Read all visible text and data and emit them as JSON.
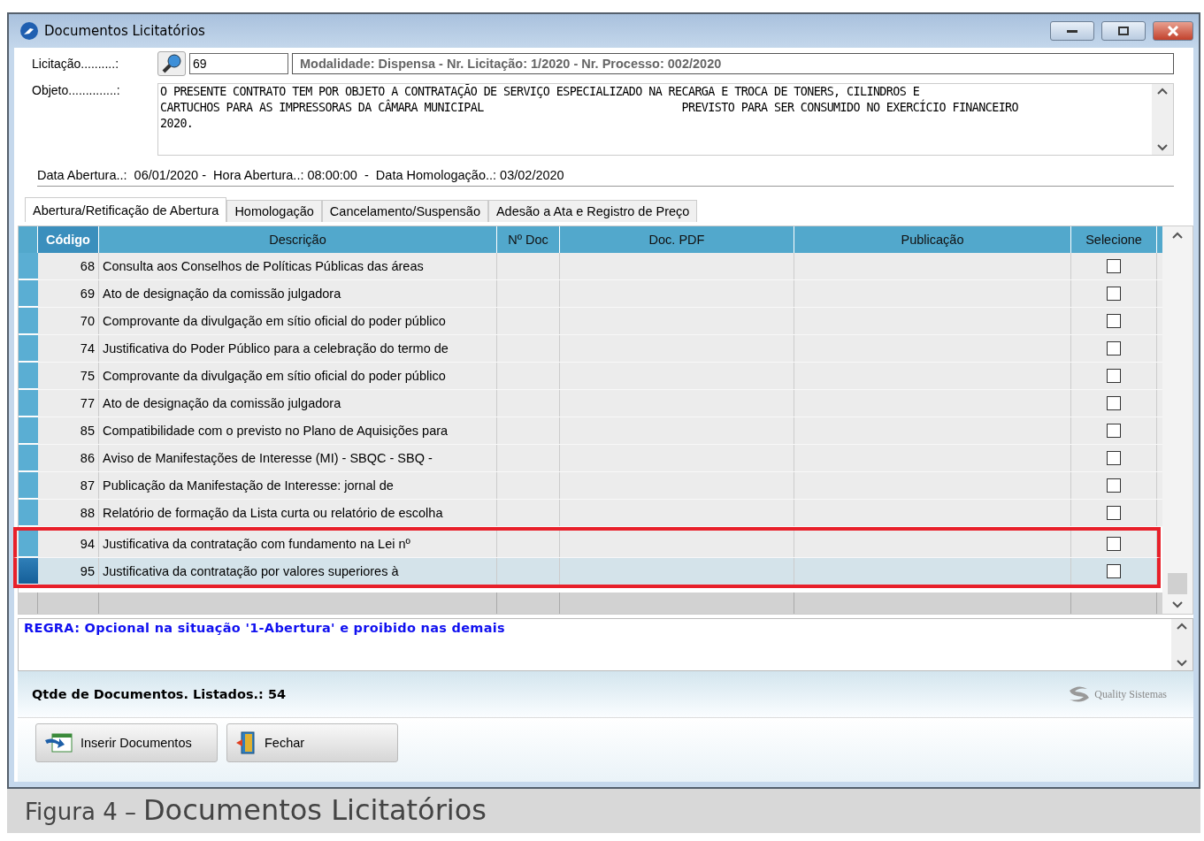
{
  "window": {
    "title": "Documentos Licitatórios"
  },
  "licitacao": {
    "label": "Licitação..........:",
    "value": "69",
    "summary": "Modalidade: Dispensa - Nr. Licitação: 1/2020 - Nr. Processo: 002/2020"
  },
  "objeto": {
    "label": "Objeto..............:",
    "lines": [
      "O PRESENTE CONTRATO TEM POR OBJETO A CONTRATAÇÃO DE SERVIÇO ESPECIALIZADO NA RECARGA E TROCA DE TONERS, CILINDROS E",
      "CARTUCHOS PARA AS IMPRESSORAS DA CÂMARA MUNICIPAL                              PREVISTO PARA SER CONSUMIDO NO EXERCÍCIO FINANCEIRO",
      "2020."
    ]
  },
  "dates": "Data Abertura..:  06/01/2020 -  Hora Abertura..: 08:00:00  -  Data Homologação..: 03/02/2020",
  "tabs": [
    {
      "label": "Abertura/Retificação de Abertura",
      "selected": true
    },
    {
      "label": "Homologação",
      "selected": false
    },
    {
      "label": "Cancelamento/Suspensão",
      "selected": false
    },
    {
      "label": "Adesão a Ata e Registro de Preço",
      "selected": false
    }
  ],
  "table": {
    "columns": [
      "Código",
      "Descrição",
      "Nº Doc",
      "Doc. PDF",
      "Publicação",
      "Selecione"
    ],
    "rows": [
      {
        "codigo": "68",
        "descricao": "Consulta aos Conselhos de Políticas Públicas das áreas",
        "checked": false,
        "selected": false,
        "highlighted": false
      },
      {
        "codigo": "69",
        "descricao": "Ato de designação da comissão julgadora",
        "checked": false,
        "selected": false,
        "highlighted": false
      },
      {
        "codigo": "70",
        "descricao": "Comprovante da divulgação em sítio oficial do poder público",
        "checked": false,
        "selected": false,
        "highlighted": false
      },
      {
        "codigo": "74",
        "descricao": "Justificativa do Poder Público para a celebração do termo de",
        "checked": false,
        "selected": false,
        "highlighted": false
      },
      {
        "codigo": "75",
        "descricao": "Comprovante da divulgação em sítio oficial do poder público",
        "checked": false,
        "selected": false,
        "highlighted": false
      },
      {
        "codigo": "77",
        "descricao": "Ato de designação da comissão julgadora",
        "checked": false,
        "selected": false,
        "highlighted": false
      },
      {
        "codigo": "85",
        "descricao": "Compatibilidade com o previsto no Plano de Aquisições para",
        "checked": false,
        "selected": false,
        "highlighted": false
      },
      {
        "codigo": "86",
        "descricao": "Aviso de Manifestações de Interesse (MI) - SBQC - SBQ -",
        "checked": false,
        "selected": false,
        "highlighted": false
      },
      {
        "codigo": "87",
        "descricao": "Publicação da Manifestação de Interesse: jornal de",
        "checked": false,
        "selected": false,
        "highlighted": false
      },
      {
        "codigo": "88",
        "descricao": "Relatório de formação da Lista curta ou relatório de escolha",
        "checked": false,
        "selected": false,
        "highlighted": false
      },
      {
        "codigo": "94",
        "descricao": "Justificativa da contratação com fundamento na Lei nº",
        "checked": false,
        "selected": false,
        "highlighted": true
      },
      {
        "codigo": "95",
        "descricao": "Justificativa da contratação por valores superiores à",
        "checked": false,
        "selected": true,
        "highlighted": true
      }
    ]
  },
  "rule": "REGRA: Opcional na situação '1-Abertura' e proibido nas demais",
  "footer": {
    "count": "Qtde de Documentos. Listados.: 54",
    "logo": "Quality Sistemas"
  },
  "buttons": [
    {
      "kind": "insert",
      "label": "Inserir Documentos"
    },
    {
      "kind": "close",
      "label": "Fechar"
    }
  ],
  "caption": {
    "prefix": "Figura 4 –",
    "title": "Documentos Licitatórios"
  }
}
